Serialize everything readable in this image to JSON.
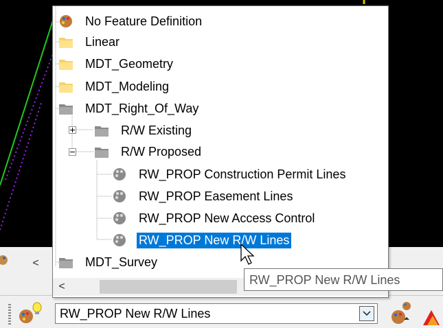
{
  "canvas": {
    "background": "#000000"
  },
  "tree": {
    "items": [
      {
        "label": "No Feature Definition",
        "icon": "feature-palette-icon"
      },
      {
        "label": "Linear",
        "icon": "folder-yellow-icon"
      },
      {
        "label": "MDT_Geometry",
        "icon": "folder-yellow-icon"
      },
      {
        "label": "MDT_Modeling",
        "icon": "folder-yellow-icon"
      },
      {
        "label": "MDT_Right_Of_Way",
        "icon": "folder-gray-icon"
      },
      {
        "label": "R/W Existing",
        "icon": "folder-gray-icon",
        "expander": "plus"
      },
      {
        "label": "R/W Proposed",
        "icon": "folder-gray-icon",
        "expander": "minus"
      },
      {
        "label": "RW_PROP Construction Permit Lines",
        "icon": "feature-palette-icon"
      },
      {
        "label": "RW_PROP Easement Lines",
        "icon": "feature-palette-icon"
      },
      {
        "label": "RW_PROP New Access Control",
        "icon": "feature-palette-icon"
      },
      {
        "label": "RW_PROP New R/W Lines",
        "icon": "feature-palette-icon",
        "selected": true
      },
      {
        "label": "MDT_Survey",
        "icon": "folder-gray-icon"
      }
    ],
    "selected_color": "#0078d7"
  },
  "tree_scroll": {
    "left_arrow": "<"
  },
  "left_panel": {
    "scroll_left": "<"
  },
  "tooltip": {
    "text": "RW_PROP New R/W Lines"
  },
  "combo": {
    "value": "RW_PROP New R/W Lines",
    "arrow_icon": "chevron-down-icon"
  },
  "toolbar": {
    "left_icon": "feature-lightbulb-icon",
    "right_icon": "feature-pick-icon"
  }
}
